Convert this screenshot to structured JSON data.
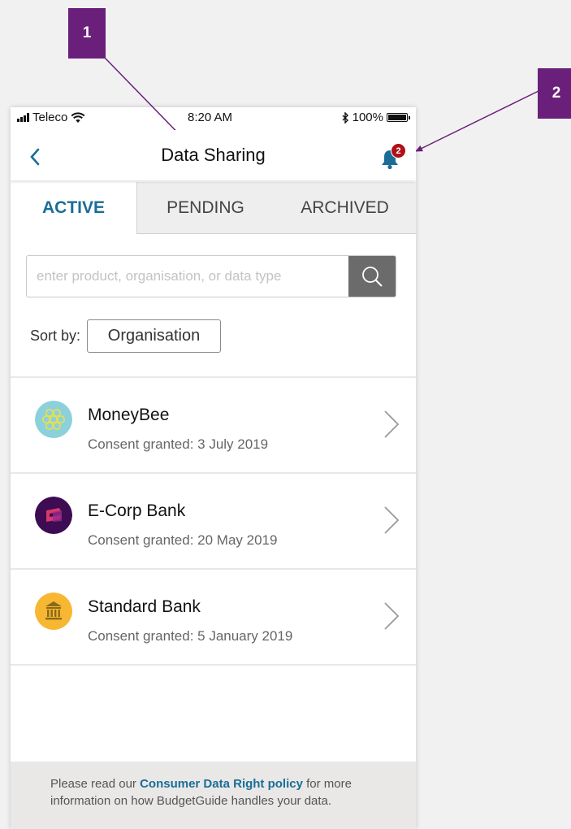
{
  "callouts": {
    "one": "1",
    "two": "2"
  },
  "status_bar": {
    "carrier": "Teleco",
    "time": "8:20 AM",
    "battery": "100%"
  },
  "nav": {
    "title": "Data Sharing",
    "notification_count": "2"
  },
  "tabs": [
    {
      "label": "ACTIVE",
      "active": true
    },
    {
      "label": "PENDING",
      "active": false
    },
    {
      "label": "ARCHIVED",
      "active": false
    }
  ],
  "search": {
    "placeholder": "enter product, organisation, or data type"
  },
  "sort": {
    "label": "Sort by:",
    "value": "Organisation"
  },
  "items": [
    {
      "name": "MoneyBee",
      "consent": "Consent granted: 3 July 2019",
      "icon": "honeycomb-logo-icon"
    },
    {
      "name": "E-Corp Bank",
      "consent": "Consent granted: 20 May 2019",
      "icon": "ecorp-logo-icon"
    },
    {
      "name": "Standard Bank",
      "consent": "Consent granted: 5 January 2019",
      "icon": "bank-building-logo-icon"
    }
  ],
  "footer": {
    "prefix": "Please read our ",
    "link": "Consumer Data Right policy",
    "suffix": " for more information on how BudgetGuide handles your data."
  },
  "colors": {
    "accent": "#1a6e96",
    "callout": "#6a1f7a",
    "badge": "#b0101a",
    "footer_bg": "#e9e8e7"
  }
}
